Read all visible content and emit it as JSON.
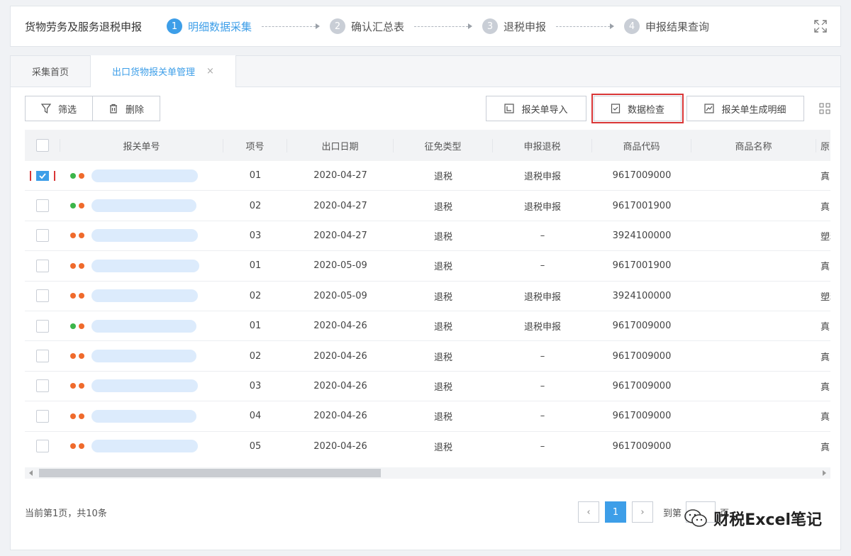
{
  "app": {
    "title": "货物劳务及服务退税申报"
  },
  "steps": [
    {
      "num": "1",
      "label": "明细数据采集"
    },
    {
      "num": "2",
      "label": "确认汇总表"
    },
    {
      "num": "3",
      "label": "退税申报"
    },
    {
      "num": "4",
      "label": "申报结果查询"
    }
  ],
  "tabs": [
    {
      "label": "采集首页"
    },
    {
      "label": "出口货物报关单管理",
      "close": "×"
    }
  ],
  "toolbar": {
    "filter": "筛选",
    "delete": "删除",
    "import": "报关单导入",
    "check": "数据检查",
    "generate": "报关单生成明细"
  },
  "table": {
    "headers": [
      "报关单号",
      "项号",
      "出口日期",
      "征免类型",
      "申报退税",
      "商品代码",
      "商品名称",
      "原"
    ],
    "rows": [
      {
        "checked": true,
        "dots": [
          "#3bb54a",
          "#ef6a2c"
        ],
        "item": "01",
        "date": "2020-04-27",
        "type": "退税",
        "decl": "退税申报",
        "code": "9617009000",
        "name": "真空保"
      },
      {
        "checked": false,
        "dots": [
          "#3bb54a",
          "#ef6a2c"
        ],
        "item": "02",
        "date": "2020-04-27",
        "type": "退税",
        "decl": "退税申报",
        "code": "9617001900",
        "name": "真空保"
      },
      {
        "checked": false,
        "dots": [
          "#ef6a2c",
          "#ef6a2c"
        ],
        "item": "03",
        "date": "2020-04-27",
        "type": "退税",
        "decl": "–",
        "code": "3924100000",
        "name": "塑料杯"
      },
      {
        "checked": false,
        "dots": [
          "#ef6a2c",
          "#ef6a2c"
        ],
        "item": "01",
        "date": "2020-05-09",
        "type": "退税",
        "decl": "–",
        "code": "9617001900",
        "name": "真空保"
      },
      {
        "checked": false,
        "dots": [
          "#ef6a2c",
          "#ef6a2c"
        ],
        "item": "02",
        "date": "2020-05-09",
        "type": "退税",
        "decl": "退税申报",
        "code": "3924100000",
        "name": "塑料制"
      },
      {
        "checked": false,
        "dots": [
          "#3bb54a",
          "#ef6a2c"
        ],
        "item": "01",
        "date": "2020-04-26",
        "type": "退税",
        "decl": "退税申报",
        "code": "9617009000",
        "name": "真空保"
      },
      {
        "checked": false,
        "dots": [
          "#ef6a2c",
          "#ef6a2c"
        ],
        "item": "02",
        "date": "2020-04-26",
        "type": "退税",
        "decl": "–",
        "code": "9617009000",
        "name": "真空保"
      },
      {
        "checked": false,
        "dots": [
          "#ef6a2c",
          "#ef6a2c"
        ],
        "item": "03",
        "date": "2020-04-26",
        "type": "退税",
        "decl": "–",
        "code": "9617009000",
        "name": "真空保"
      },
      {
        "checked": false,
        "dots": [
          "#ef6a2c",
          "#ef6a2c"
        ],
        "item": "04",
        "date": "2020-04-26",
        "type": "退税",
        "decl": "–",
        "code": "9617009000",
        "name": "真空保"
      },
      {
        "checked": false,
        "dots": [
          "#ef6a2c",
          "#ef6a2c"
        ],
        "item": "05",
        "date": "2020-04-26",
        "type": "退税",
        "decl": "–",
        "code": "9617009000",
        "name": "真空保"
      }
    ]
  },
  "footer": {
    "info": "当前第1页，共10条",
    "current_page": "1",
    "goto_prefix": "到第",
    "goto_suffix": "页"
  },
  "watermark": {
    "text": "财税Excel笔记"
  },
  "colors": {
    "accent": "#3d9ee8",
    "highlight": "#d93636",
    "dot_green": "#3bb54a",
    "dot_orange": "#ef6a2c"
  }
}
